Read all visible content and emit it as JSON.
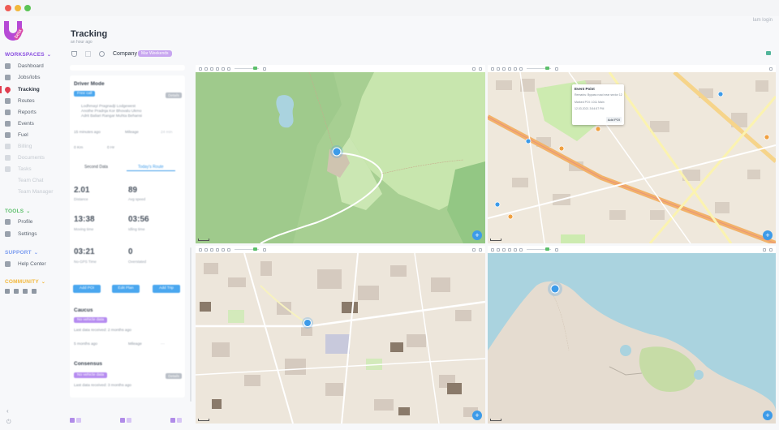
{
  "header": {
    "title": "Tracking",
    "subtitle": "an hour ago",
    "filter_label": "Company",
    "filter_chip": "Mar Weekends",
    "topright": [
      "",
      "Iam login"
    ]
  },
  "sidebar": {
    "workspaces_label": "WORKSPACES",
    "items": [
      {
        "label": "Dashboard",
        "state": "normal"
      },
      {
        "label": "Jobs/lobs",
        "state": "normal"
      },
      {
        "label": "Tracking",
        "state": "active"
      },
      {
        "label": "Routes",
        "state": "normal"
      },
      {
        "label": "Reports",
        "state": "normal"
      },
      {
        "label": "Events",
        "state": "normal"
      },
      {
        "label": "Fuel",
        "state": "normal"
      },
      {
        "label": "Billing",
        "state": "faded"
      },
      {
        "label": "Documents",
        "state": "faded"
      },
      {
        "label": "Tasks",
        "state": "faded"
      },
      {
        "label": "Team Chat",
        "state": "sub"
      },
      {
        "label": "Team Manager",
        "state": "sub"
      }
    ],
    "tools_label": "TOOLS",
    "tools_items": [
      "Profile",
      "Settings"
    ],
    "support_label": "SUPPORT",
    "support_items": [
      "Help Center"
    ],
    "community_label": "COMMUNITY"
  },
  "list": {
    "card1": {
      "title": "Driver Mode",
      "tag": "Free call",
      "gray_badge": "Details",
      "lines": [
        "Lodhmayi Pragnadji Lodgewest",
        "Anothe Pradnja Kor Bhovalu Ukmo",
        "Adrit Baliari Rangar Muhta Behansi"
      ],
      "stats_row": [
        "15 minutes ago",
        "Mileage",
        "24 min"
      ],
      "stats_row2": [
        "0 Km",
        "0 Hr"
      ],
      "tabs": [
        "Second Data",
        "Today's Route"
      ],
      "values": [
        {
          "value": "2.01",
          "label": "Distance"
        },
        {
          "value": "89",
          "label": "Avg speed"
        },
        {
          "value": "13:38",
          "label": "Moving time"
        },
        {
          "value": "03:56",
          "label": "Idling time"
        },
        {
          "value": "03:21",
          "label": "No-GPS Time"
        },
        {
          "value": "0",
          "label": "Overstated"
        }
      ],
      "buttons": [
        "Add POI",
        "Edit Plan",
        "Add Trip"
      ]
    },
    "card2": {
      "title": "Caucus",
      "tag": "No vehicle data",
      "line": "Last data received: 2 months ago",
      "stats": [
        "5 months ago",
        "Mileage",
        "---"
      ]
    },
    "card3": {
      "title": "Consensus",
      "tag": "No vehicle data",
      "gray_badge": "Details",
      "line": "Last data received: 3 months ago"
    }
  },
  "popup": {
    "title": "Event Point",
    "lines": [
      "Remarks: Bypass road near sector 12",
      "Marked POI: 1011 Main",
      "12.03.2021 3:54:57 PM"
    ],
    "button": "Add POI"
  },
  "panes": [
    {
      "name": "map-pane-1",
      "theme": "park"
    },
    {
      "name": "map-pane-2",
      "theme": "city"
    },
    {
      "name": "map-pane-3",
      "theme": "city"
    },
    {
      "name": "map-pane-4",
      "theme": "coast"
    }
  ],
  "colors": {
    "accent": "#8a4fe0",
    "active": "#e03d4f",
    "fab": "#3d9be9",
    "tools_label": "#5bbf6a",
    "support_label": "#7b9cf0",
    "community_label": "#f2b83c"
  }
}
